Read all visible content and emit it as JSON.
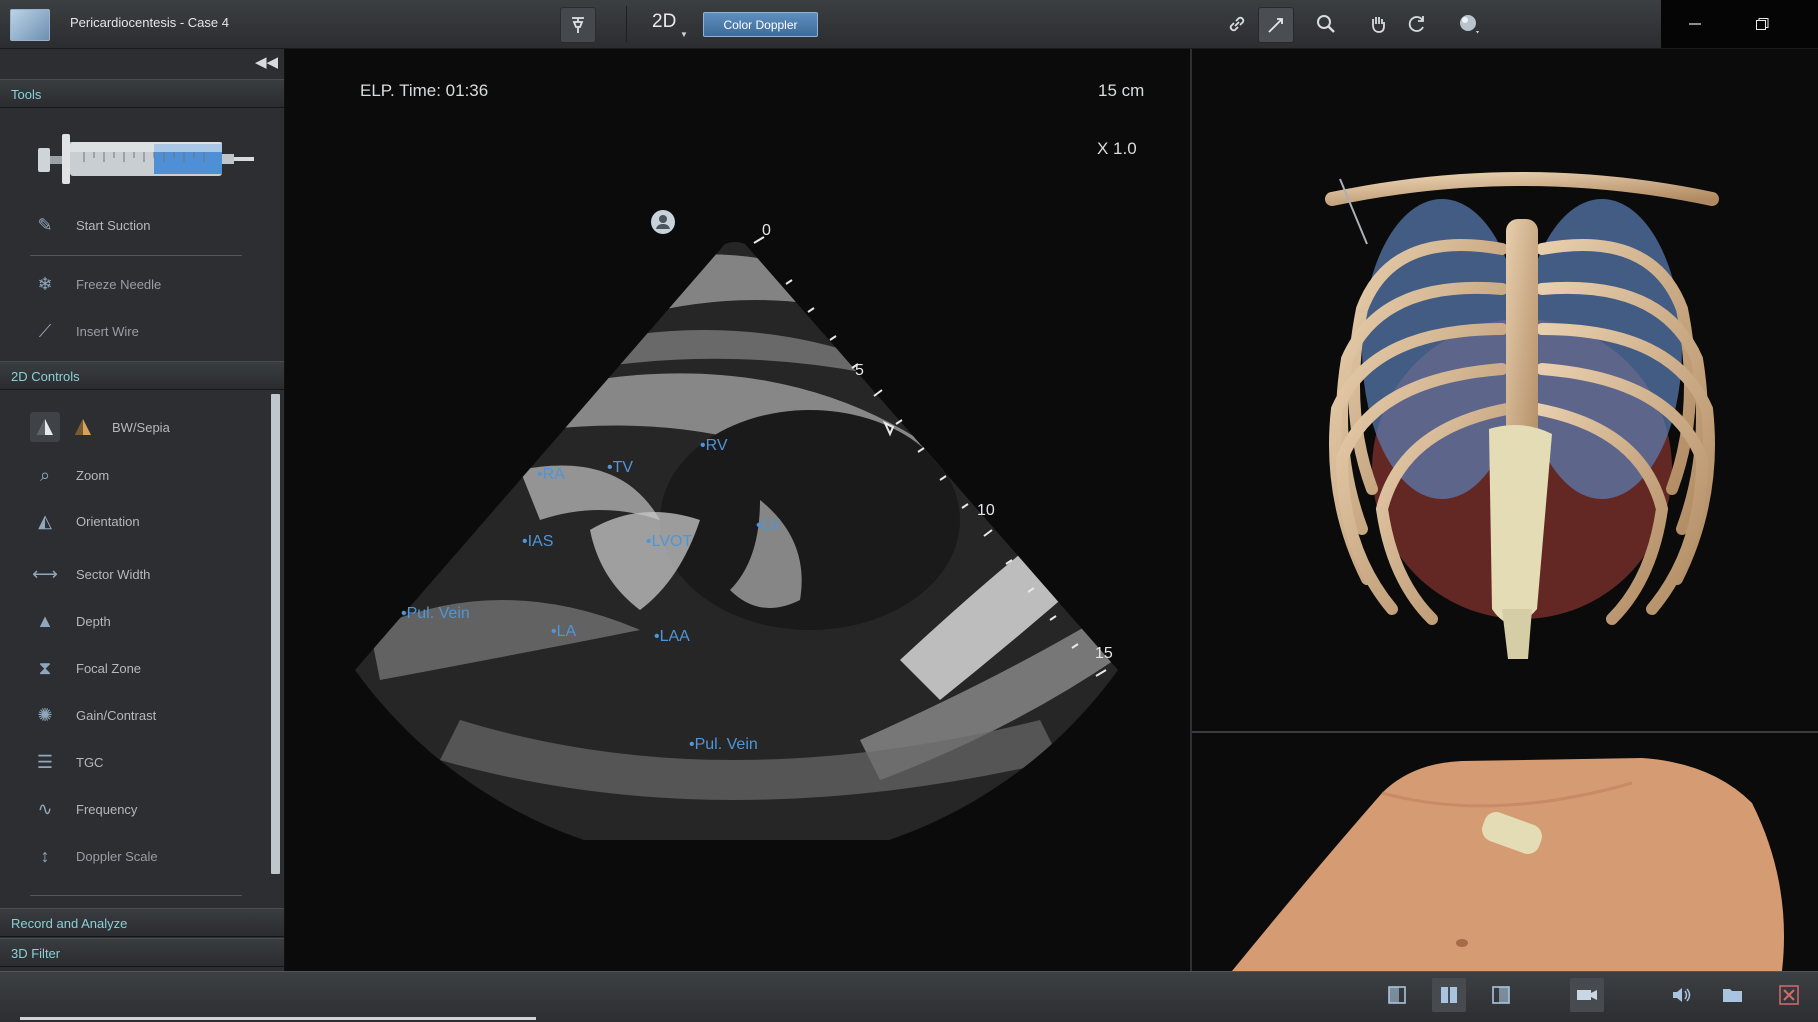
{
  "window": {
    "title": "Pericardiocentesis - Case 4",
    "mode": "2D",
    "doppler_button": "Color Doppler"
  },
  "left_panel": {
    "tools_header": "Tools",
    "tools": [
      {
        "label": "Start Suction",
        "icon": "syringe-icon"
      },
      {
        "label": "Freeze Needle",
        "icon": "snowflake-icon"
      },
      {
        "label": "Insert Wire",
        "icon": "wire-icon"
      }
    ],
    "controls_header": "2D Controls",
    "controls": [
      {
        "label": "BW/Sepia",
        "icon": "bw-sepia-icon"
      },
      {
        "label": "Zoom",
        "icon": "zoom-icon"
      },
      {
        "label": "Orientation",
        "icon": "orientation-icon"
      },
      {
        "label": "Sector Width",
        "icon": "sector-width-icon"
      },
      {
        "label": "Depth",
        "icon": "depth-icon"
      },
      {
        "label": "Focal Zone",
        "icon": "focal-zone-icon"
      },
      {
        "label": "Gain/Contrast",
        "icon": "gain-contrast-icon"
      },
      {
        "label": "TGC",
        "icon": "tgc-icon"
      },
      {
        "label": "Frequency",
        "icon": "frequency-icon"
      },
      {
        "label": "Doppler Scale",
        "icon": "doppler-scale-icon"
      }
    ],
    "record_header": "Record and Analyze",
    "filter_header": "3D Filter"
  },
  "ultrasound": {
    "elapsed_time": "ELP. Time: 01:36",
    "depth": "15 cm",
    "zoom": "X 1.0",
    "depth_ticks": [
      "0",
      "5",
      "10",
      "15"
    ],
    "labels": {
      "ra": "RA",
      "tv": "TV",
      "rv": "RV",
      "ias": "IAS",
      "lvot": "LVOT",
      "lv": "LV",
      "pul_vein_left": "Pul. Vein",
      "la": "LA",
      "laa": "LAA",
      "pul_vein_bottom": "Pul. Vein"
    }
  },
  "colors": {
    "label_blue": "#4f95d8",
    "accent_teal": "#8ad0d8",
    "panel_bg": "#2c2e31"
  }
}
